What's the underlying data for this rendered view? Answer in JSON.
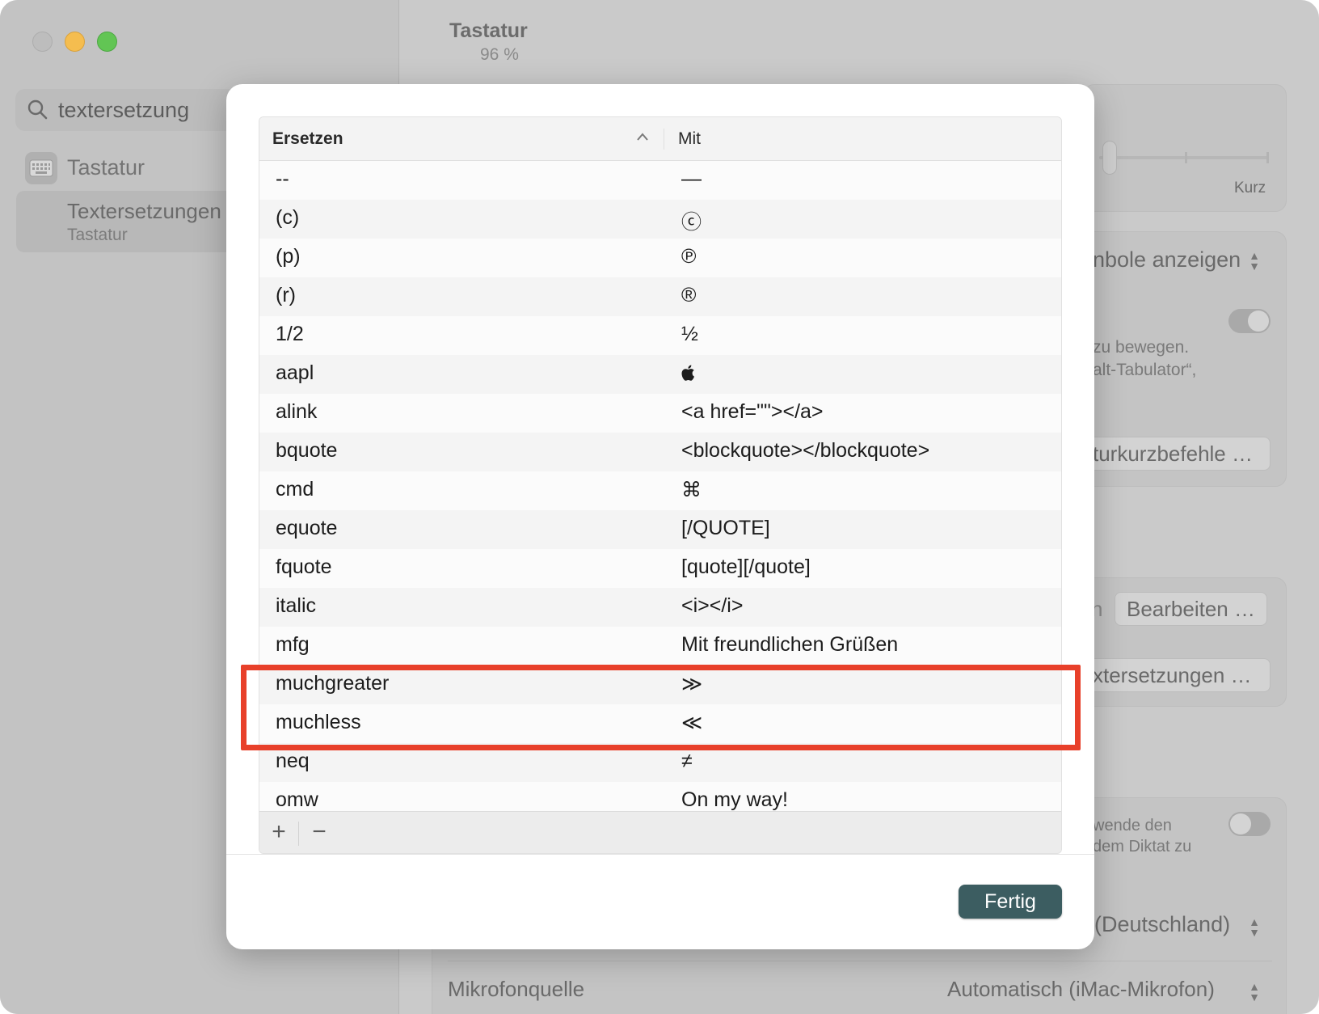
{
  "window": {
    "sidebar": {
      "search_value": "textersetzung",
      "items": [
        {
          "label": "Tastatur",
          "icon": "keyboard-icon"
        }
      ],
      "selected": {
        "title": "Textersetzungen",
        "subtitle": "Tastatur"
      }
    },
    "content": {
      "title": "Tastatur",
      "subtitle": "96 %",
      "slider_label": "Kurz",
      "fragments": {
        "symbols": "nbole anzeigen",
        "move_text_1": "zu bewegen.",
        "move_text_2": "alt-Tabulator“,",
        "shortcuts_button": "turkurzbefehle …",
        "edit_prefix": "n",
        "edit_button": "Bearbeiten …",
        "replacements_button": "xtersetzungen …",
        "dictation_1": "wende den",
        "dictation_2": "dem Diktat zu",
        "language": "(Deutschland)",
        "mic_label": "Mikrofonquelle",
        "mic_value": "Automatisch (iMac-Mikrofon)"
      }
    }
  },
  "sheet": {
    "columns": {
      "replace": "Ersetzen",
      "with": "Mit"
    },
    "rows": [
      {
        "replace": "--",
        "with": "—"
      },
      {
        "replace": "(c)",
        "with": "ⓒ"
      },
      {
        "replace": "(p)",
        "with": "℗"
      },
      {
        "replace": "(r)",
        "with": "®"
      },
      {
        "replace": "1/2",
        "with": "½"
      },
      {
        "replace": "aapl",
        "with": ""
      },
      {
        "replace": "alink",
        "with": "<a href=\"\"></a>"
      },
      {
        "replace": "bquote",
        "with": "<blockquote></blockquote>"
      },
      {
        "replace": "cmd",
        "with": "⌘"
      },
      {
        "replace": "equote",
        "with": "[/QUOTE]"
      },
      {
        "replace": "fquote",
        "with": "[quote][/quote]"
      },
      {
        "replace": "italic",
        "with": "<i></i>"
      },
      {
        "replace": "mfg",
        "with": "Mit freundlichen Grüßen"
      },
      {
        "replace": "muchgreater",
        "with": "≫"
      },
      {
        "replace": "muchless",
        "with": "≪"
      },
      {
        "replace": "neq",
        "with": "≠"
      },
      {
        "replace": "omw",
        "with": "On my way!"
      }
    ],
    "add_label": "+",
    "remove_label": "−",
    "done_label": "Fertig"
  },
  "colors": {
    "highlight": "#e8402a",
    "done_button": "#3c5d61"
  }
}
